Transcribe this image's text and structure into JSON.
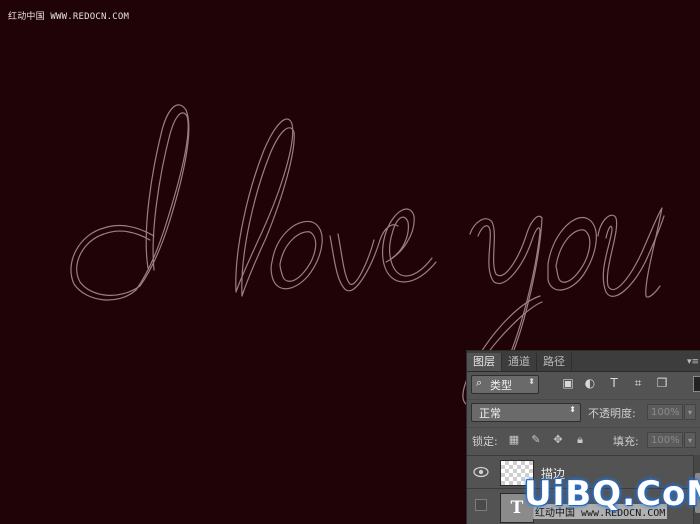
{
  "canvas": {
    "background_color": "#200306",
    "watermark_top": "红动中国 WWW.REDOCN.COM",
    "script_text": "I love you",
    "stroke_color": "#9a7f82"
  },
  "layers_panel": {
    "tabs": [
      {
        "label": "图层",
        "active": true
      },
      {
        "label": "通道",
        "active": false
      },
      {
        "label": "路径",
        "active": false
      }
    ],
    "panel_menu_icon": "panel-menu-icon",
    "filter": {
      "kind_label": "类型",
      "filter_icons": [
        "image-filter-icon",
        "adjustment-filter-icon",
        "type-filter-icon",
        "shape-filter-icon",
        "smart-object-filter-icon"
      ]
    },
    "blend_mode": "正常",
    "opacity_label": "不透明度:",
    "opacity_value": "100%",
    "lock_label": "锁定:",
    "lock_icons": [
      "lock-transparent-icon",
      "lock-brush-icon",
      "lock-move-icon",
      "lock-all-icon"
    ],
    "fill_label": "填充:",
    "fill_value": "100%",
    "layers": [
      {
        "name": "描边",
        "visible": true,
        "type": "raster"
      },
      {
        "name": "",
        "visible": false,
        "type": "text",
        "thumb_glyph": "T"
      }
    ]
  },
  "watermark_bottom": "红动中国 www.REDOCN.COM",
  "logo_text": "UiBQ.CoM"
}
